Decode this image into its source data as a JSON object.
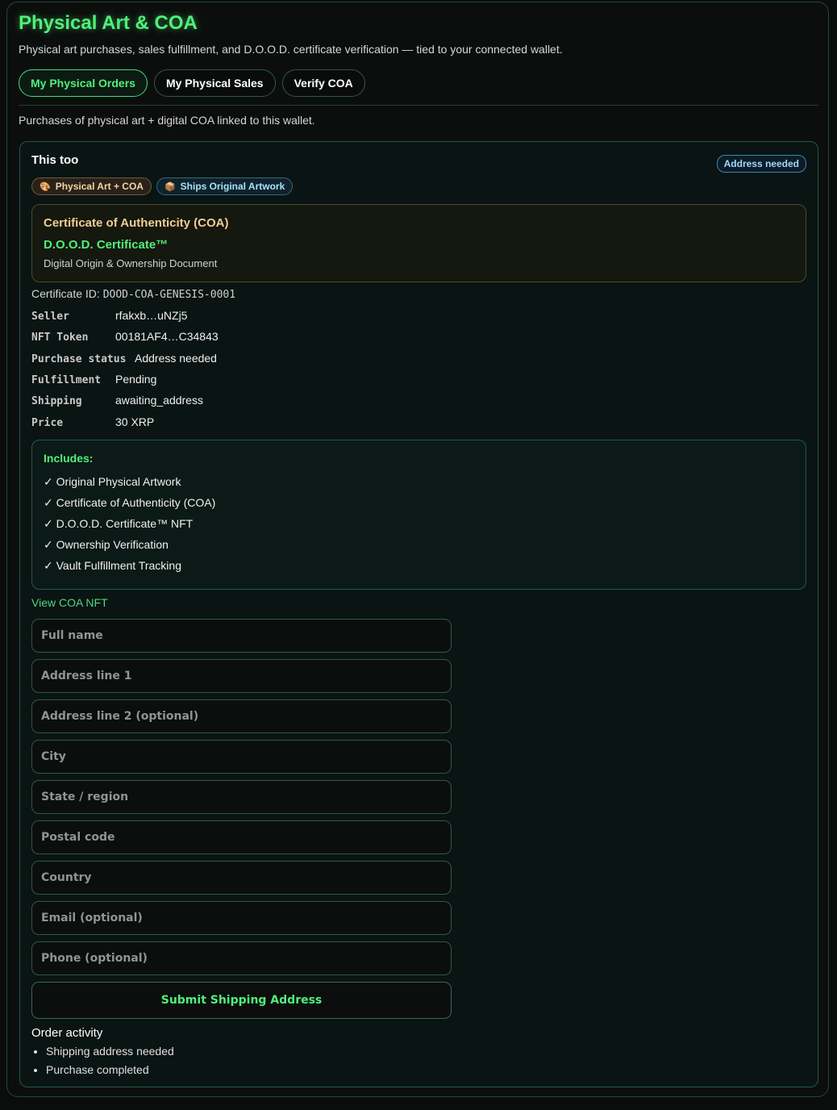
{
  "page": {
    "title": "Physical Art & COA",
    "subtitle": "Physical art purchases, sales fulfillment, and D.O.O.D. certificate verification — tied to your connected wallet."
  },
  "tabs": [
    {
      "label": "My Physical Orders",
      "active": true
    },
    {
      "label": "My Physical Sales",
      "active": false
    },
    {
      "label": "Verify COA",
      "active": false
    }
  ],
  "section_desc": "Purchases of physical art + digital COA linked to this wallet.",
  "order": {
    "title": "This too",
    "status_badge": "Address needed",
    "chips": [
      {
        "icon": "🎨",
        "icon_name": "palette-icon",
        "label": "Physical Art + COA"
      },
      {
        "icon": "📦",
        "icon_name": "package-icon",
        "label": "Ships Original Artwork"
      }
    ],
    "coa": {
      "title": "Certificate of Authenticity (COA)",
      "dood_title": "D.O.O.D. Certificate™",
      "dood_sub": "Digital Origin & Ownership Document"
    },
    "certificate_label": "Certificate ID:",
    "certificate_id": "DOOD-COA-GENESIS-0001",
    "details": [
      {
        "label": "Seller",
        "value": "rfakxb…uNZj5"
      },
      {
        "label": "NFT Token",
        "value": "00181AF4…C34843"
      },
      {
        "label": "Purchase status",
        "value": "Address needed"
      },
      {
        "label": "Fulfillment",
        "value": "Pending"
      },
      {
        "label": "Shipping",
        "value": "awaiting_address"
      },
      {
        "label": "Price",
        "value": "30 XRP"
      }
    ],
    "includes": {
      "title": "Includes:",
      "items": [
        "✓ Original Physical Artwork",
        "✓ Certificate of Authenticity (COA)",
        "✓ D.O.O.D. Certificate™ NFT",
        "✓ Ownership Verification",
        "✓ Vault Fulfillment Tracking"
      ]
    },
    "view_link": "View COA NFT",
    "form": {
      "fields": [
        {
          "name": "full-name-field",
          "placeholder": "Full name",
          "value": ""
        },
        {
          "name": "address-line-1-field",
          "placeholder": "Address line 1",
          "value": ""
        },
        {
          "name": "address-line-2-field",
          "placeholder": "Address line 2 (optional)",
          "value": ""
        },
        {
          "name": "city-field",
          "placeholder": "City",
          "value": ""
        },
        {
          "name": "state-region-field",
          "placeholder": "State / region",
          "value": ""
        },
        {
          "name": "postal-code-field",
          "placeholder": "Postal code",
          "value": ""
        },
        {
          "name": "country-field",
          "placeholder": "Country",
          "value": ""
        },
        {
          "name": "email-field",
          "placeholder": "Email (optional)",
          "value": ""
        },
        {
          "name": "phone-field",
          "placeholder": "Phone (optional)",
          "value": ""
        }
      ],
      "submit_label": "Submit Shipping Address"
    },
    "activity": {
      "title": "Order activity",
      "items": [
        "Shipping address needed",
        "Purchase completed"
      ]
    }
  },
  "colors": {
    "accent": "#4ff07a",
    "background": "#0b0d0c",
    "border": "#1f5a48",
    "coa_gold": "#f3cc95",
    "badge_blue": "#9fd8ff"
  }
}
